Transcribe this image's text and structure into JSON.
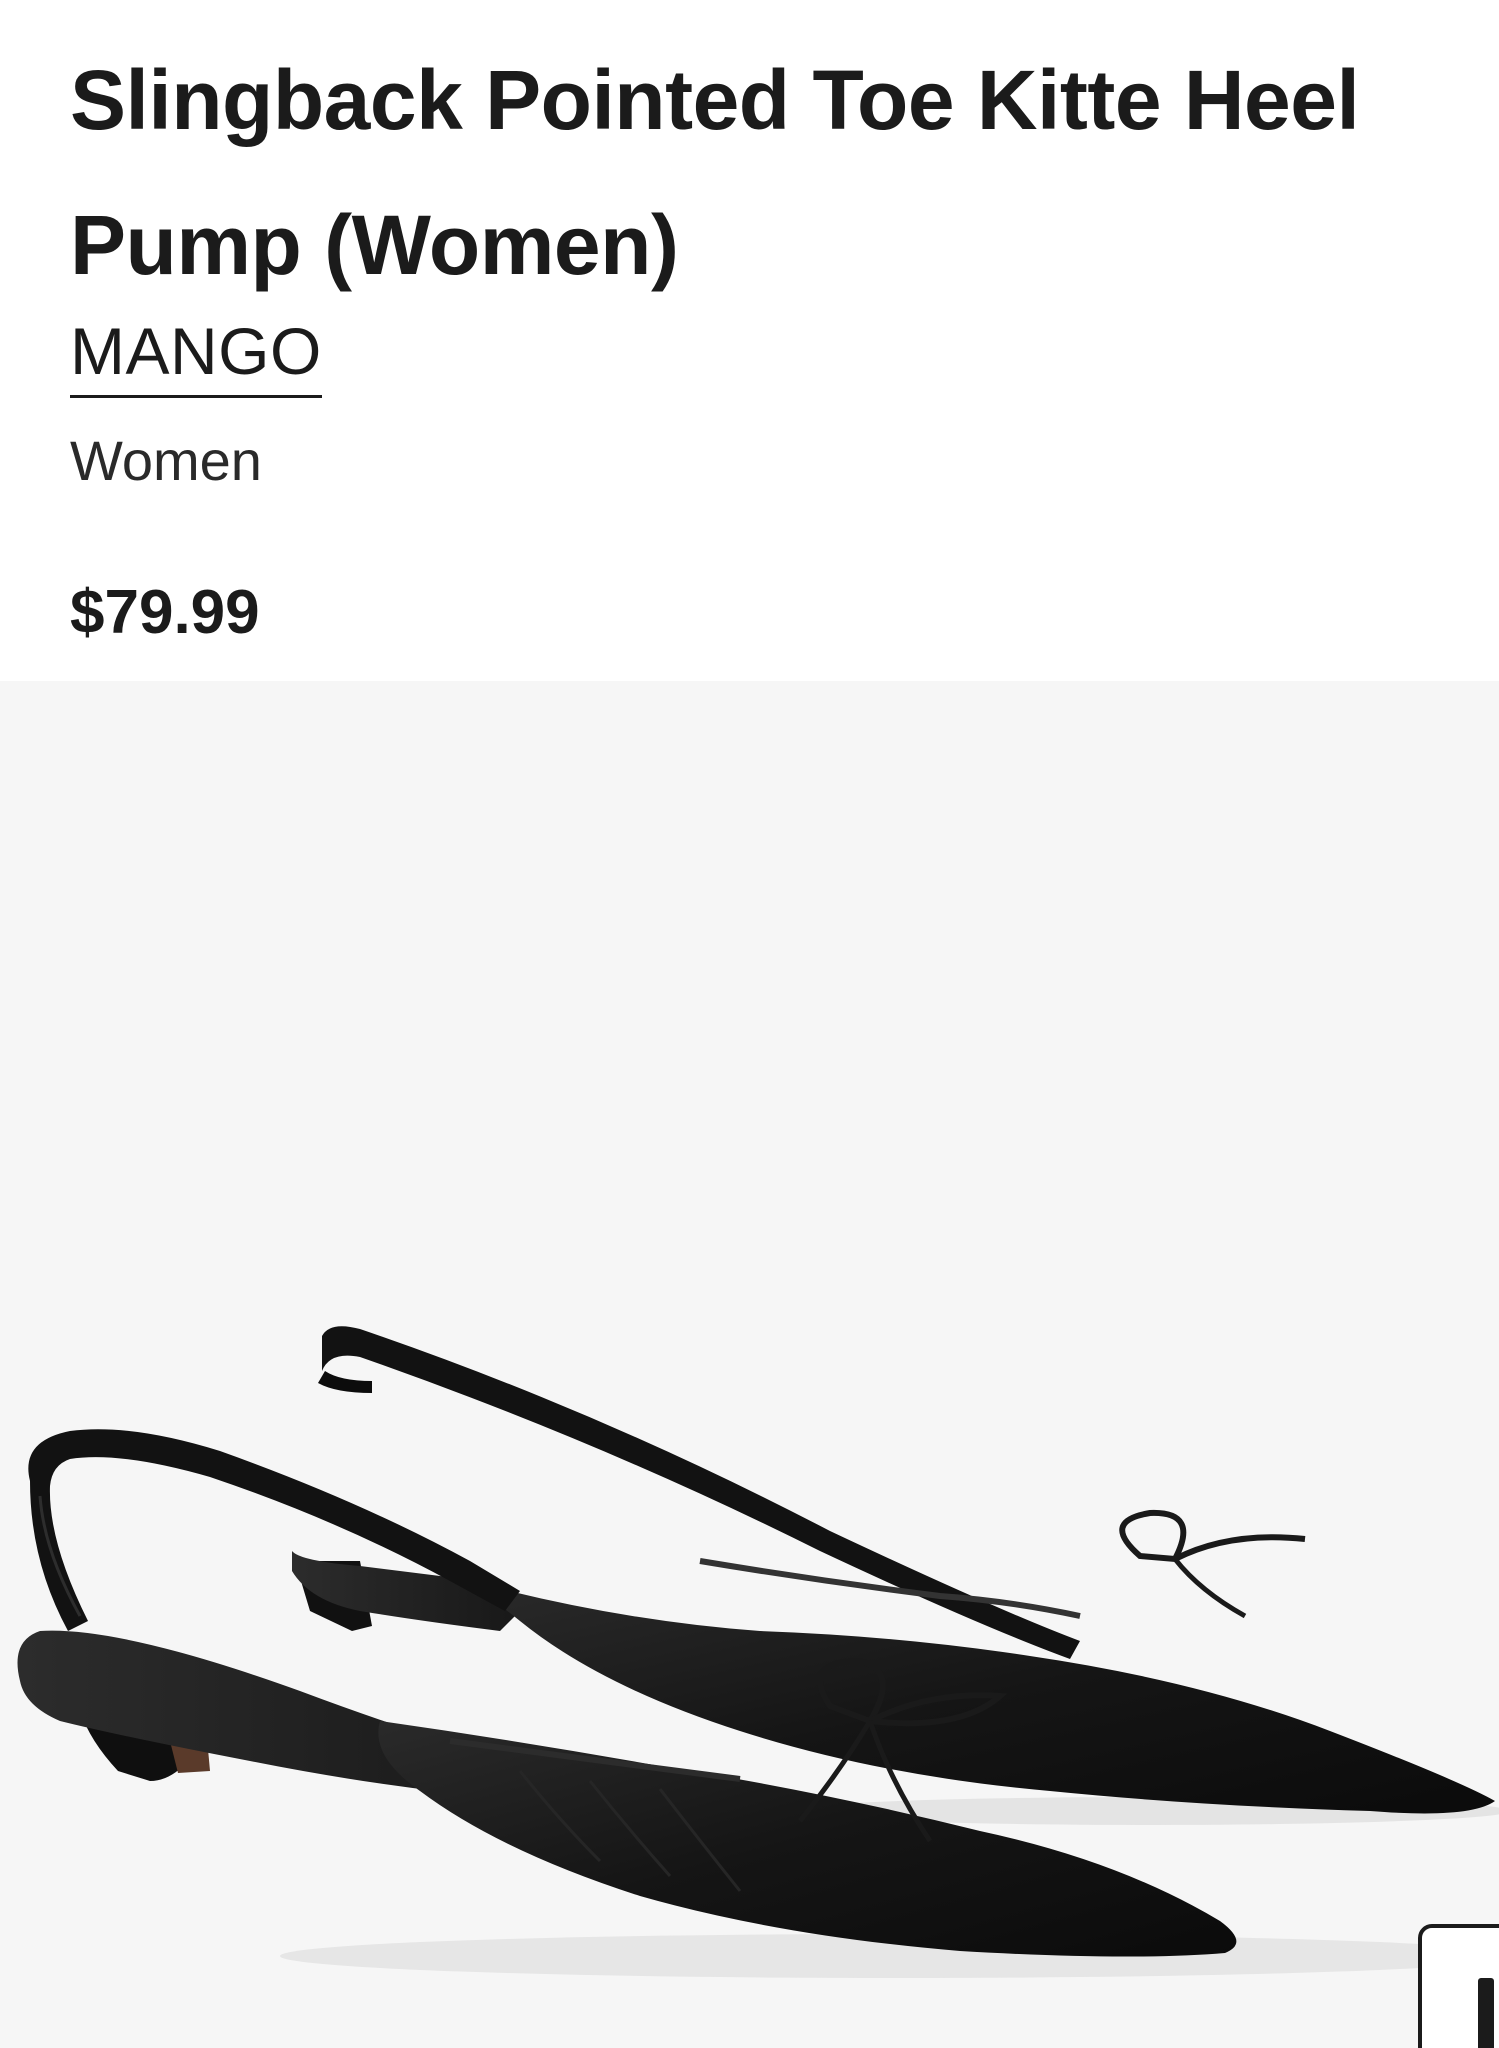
{
  "product": {
    "title_line1": "Slingback Pointed Toe Kitte Heel",
    "title_line2": "Pump (Women)",
    "brand": "MANGO",
    "category": "Women",
    "price": "$79.99"
  },
  "image": {
    "alt": "Black slingback pointed toe kitten heel pumps with bow detail"
  },
  "colors": {
    "text": "#1b1b1b",
    "image_background": "#f6f6f6",
    "shoe": "#141414"
  },
  "icons": {
    "zoom": "zoom-button-icon"
  }
}
